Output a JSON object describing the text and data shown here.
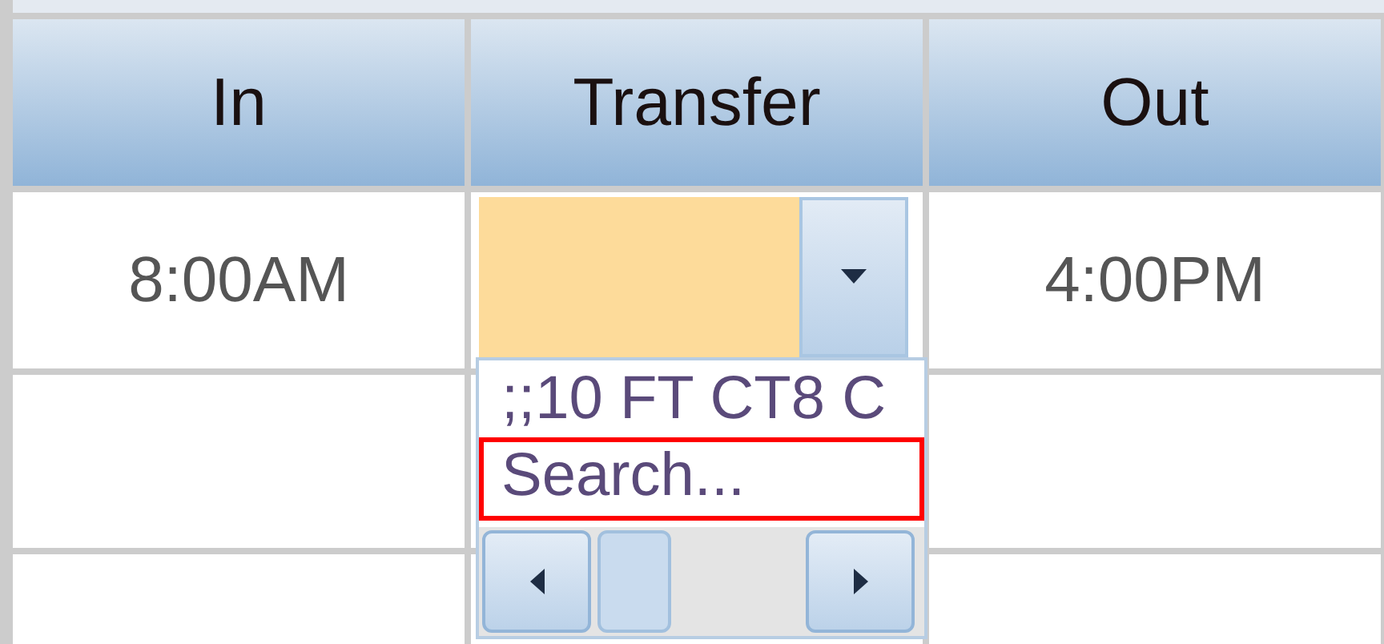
{
  "table": {
    "columns": [
      "In",
      "Transfer",
      "Out"
    ],
    "rows": [
      {
        "in": "8:00AM",
        "transfer": {
          "open": true,
          "options": [
            {
              "label": ";;10 FT CT8 C",
              "highlighted": false
            },
            {
              "label": "Search...",
              "highlighted": true
            }
          ]
        },
        "out": "4:00PM"
      },
      {
        "in": "",
        "out": ""
      },
      {
        "in": "",
        "out": ""
      }
    ]
  }
}
